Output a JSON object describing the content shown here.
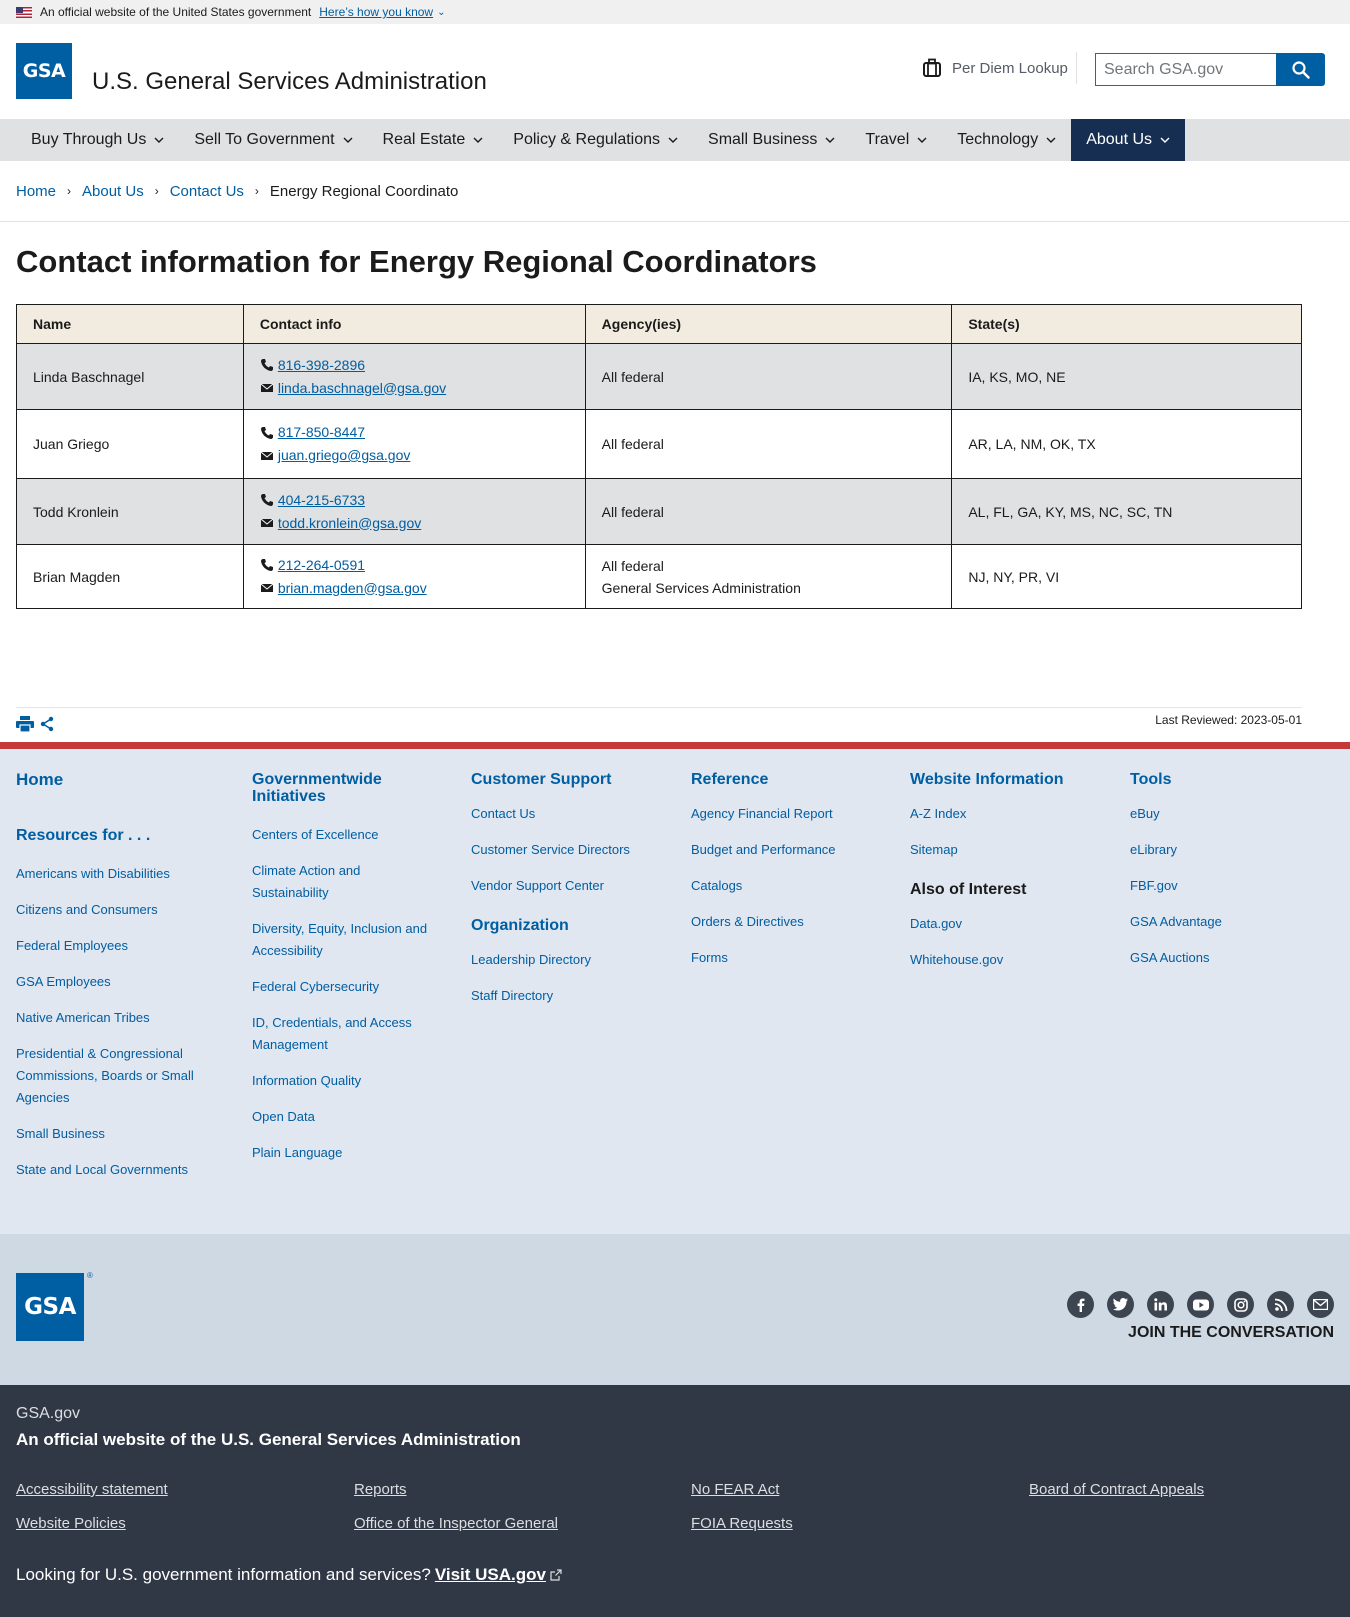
{
  "gov_banner": {
    "text": "An official website of the United States government",
    "how_link": "Here’s how you know"
  },
  "header": {
    "logo_text": "GSA",
    "site_title": "U.S. General Services Administration",
    "per_diem_label": "Per Diem Lookup",
    "search_placeholder": "Search GSA.gov"
  },
  "nav": {
    "items": [
      {
        "label": "Buy Through Us"
      },
      {
        "label": "Sell To Government"
      },
      {
        "label": "Real Estate"
      },
      {
        "label": "Policy & Regulations"
      },
      {
        "label": "Small Business"
      },
      {
        "label": "Travel"
      },
      {
        "label": "Technology"
      },
      {
        "label": "About Us",
        "active": true
      }
    ]
  },
  "breadcrumb": {
    "items": [
      "Home",
      "About Us",
      "Contact Us"
    ],
    "current": "Energy Regional Coordinato"
  },
  "main": {
    "title": "Contact information for Energy Regional Coordinators",
    "table": {
      "headers": [
        "Name",
        "Contact info",
        "Agency(ies)",
        "State(s)"
      ],
      "rows": [
        {
          "name": "Linda Baschnagel",
          "phone": "816-398-2896",
          "email": "linda.baschnagel@gsa.gov",
          "agency1": "All federal",
          "agency2": "",
          "states": "IA, KS, MO, NE"
        },
        {
          "name": "Juan Griego",
          "phone": "817-850-8447",
          "email": "juan.griego@gsa.gov",
          "agency1": "All federal",
          "agency2": "",
          "states": "AR, LA, NM, OK, TX"
        },
        {
          "name": "Todd Kronlein",
          "phone": "404-215-6733",
          "email": "todd.kronlein@gsa.gov",
          "agency1": "All federal",
          "agency2": "",
          "states": "AL, FL, GA, KY, MS, NC, SC, TN"
        },
        {
          "name": "Brian Magden",
          "phone": "212-264-0591",
          "email": "brian.magden@gsa.gov",
          "agency1": "All federal",
          "agency2": "General Services Administration",
          "states": "NJ, NY, PR, VI"
        }
      ]
    },
    "last_reviewed": "Last Reviewed: 2023-05-01"
  },
  "footer": {
    "col1": {
      "home": "Home",
      "resources_heading": "Resources for . . .",
      "links": [
        "Americans with Disabilities",
        "Citizens and Consumers",
        "Federal Employees",
        "GSA Employees",
        "Native American Tribes",
        "Presidential & Congressional Commissions, Boards or Small Agencies",
        "Small Business",
        "State and Local Governments"
      ]
    },
    "col2": {
      "heading": "Governmentwide Initiatives",
      "links": [
        "Centers of Excellence",
        "Climate Action and Sustainability",
        "Diversity, Equity, Inclusion and Accessibility",
        "Federal Cybersecurity",
        "ID, Credentials, and Access Management",
        "Information Quality",
        "Open Data",
        "Plain Language"
      ]
    },
    "col3": {
      "heading": "Customer Support",
      "links": [
        "Contact Us",
        "Customer Service Directors",
        "Vendor Support Center"
      ],
      "heading2": "Organization",
      "links2": [
        "Leadership Directory",
        "Staff Directory"
      ]
    },
    "col4": {
      "heading": "Reference",
      "links": [
        "Agency Financial Report",
        "Budget and Performance",
        "Catalogs",
        "Orders & Directives",
        "Forms"
      ]
    },
    "col5": {
      "heading": "Website Information",
      "links": [
        "A-Z Index",
        "Sitemap"
      ],
      "heading2": "Also of Interest",
      "links2": [
        "Data.gov",
        "Whitehouse.gov"
      ]
    },
    "col6": {
      "heading": "Tools",
      "links": [
        "eBuy",
        "eLibrary",
        "FBF.gov",
        "GSA Advantage",
        "GSA Auctions"
      ]
    },
    "brand": {
      "logo_text": "GSA",
      "registered": "®",
      "social_icons": [
        "facebook-icon",
        "twitter-icon",
        "linkedin-icon",
        "youtube-icon",
        "instagram-icon",
        "blog-icon",
        "email-icon"
      ],
      "join_label": "JOIN THE CONVERSATION"
    },
    "identity": {
      "domain": "GSA.gov",
      "official": "An official website of the U.S. General Services Administration",
      "links": [
        "Accessibility statement",
        "Reports",
        "No FEAR Act",
        "Board of Contract Appeals",
        "Website Policies",
        "Office of the Inspector General",
        "FOIA Requests"
      ],
      "usa_text": "Looking for U.S. government information and services?",
      "usa_link": "Visit USA.gov"
    }
  }
}
